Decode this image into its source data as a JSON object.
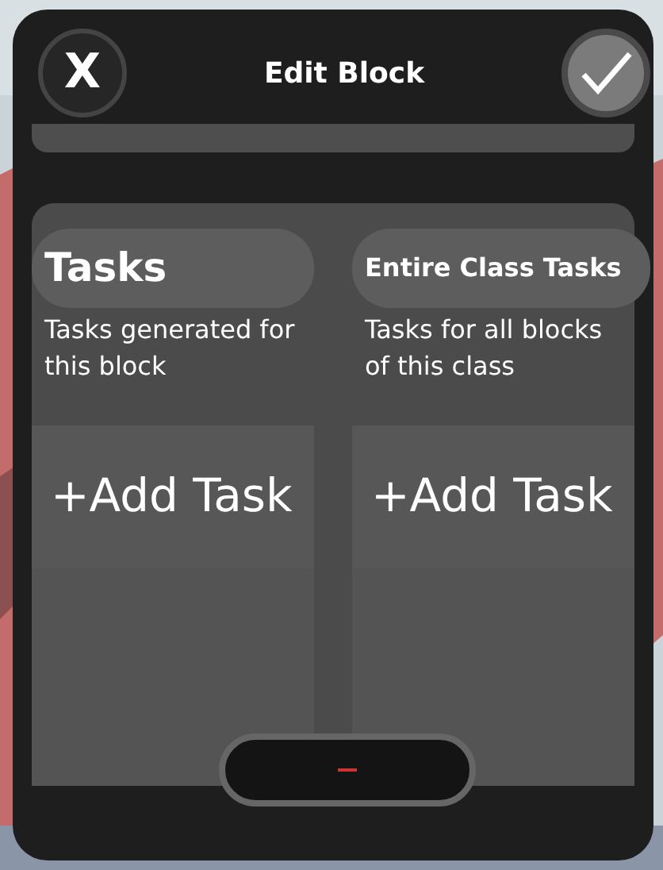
{
  "dialog": {
    "title": "Edit Block",
    "close_button": "X"
  },
  "sections": [
    {
      "title": "Tasks",
      "description": "Tasks generated for this block",
      "add_button": "+Add Task",
      "kind": "block"
    },
    {
      "title": "Entire Class Tasks",
      "description": "Tasks for all blocks of this class",
      "add_button": "+Add Task",
      "kind": "class"
    }
  ]
}
